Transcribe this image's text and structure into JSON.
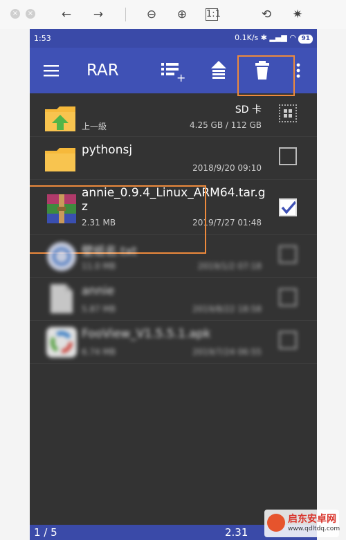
{
  "viewer": {
    "tools": [
      "back-icon",
      "forward-icon",
      "zoom-out-icon",
      "zoom-in-icon",
      "fit-icon",
      "rotate-icon",
      "magic-icon"
    ]
  },
  "status": {
    "time": "1:53",
    "speed": "0.1K/s",
    "battery": "91"
  },
  "appbar": {
    "title": "RAR"
  },
  "rows": [
    {
      "name": "上一級",
      "sub": "上一級",
      "top_label": "SD 卡",
      "date": "4.25 GB / 112 GB",
      "icon": "folder-up-icon",
      "checked": false
    },
    {
      "name": "pythonsj",
      "sub": "",
      "date": "2018/9/20 09:10",
      "icon": "folder-icon",
      "checked": false
    },
    {
      "name": "annie_0.9.4_Linux_ARM64.tar.g",
      "name2": "z",
      "sub": "2.31 MB",
      "date": "2019/7/27 01:48",
      "icon": "rar-archive-icon",
      "checked": true
    },
    {
      "name": "壁纸名.txt",
      "sub": "11.0 MB",
      "date": "2019/1/2 07:18",
      "icon": "file-blurred-icon",
      "checked": false
    },
    {
      "name": "annie",
      "sub": "5.87 MB",
      "date": "2019/8/22 18:58",
      "icon": "document-icon",
      "checked": false
    },
    {
      "name": "FooView_V1.5.5.1.apk",
      "sub": "6.74 MB",
      "date": "2019/7/24 06:55",
      "icon": "app-icon",
      "checked": false
    }
  ],
  "bottom": {
    "page": "1 / 5",
    "size": "2.31"
  },
  "watermark": {
    "title": "启东安卓网",
    "url": "www.qdltdq.com"
  }
}
